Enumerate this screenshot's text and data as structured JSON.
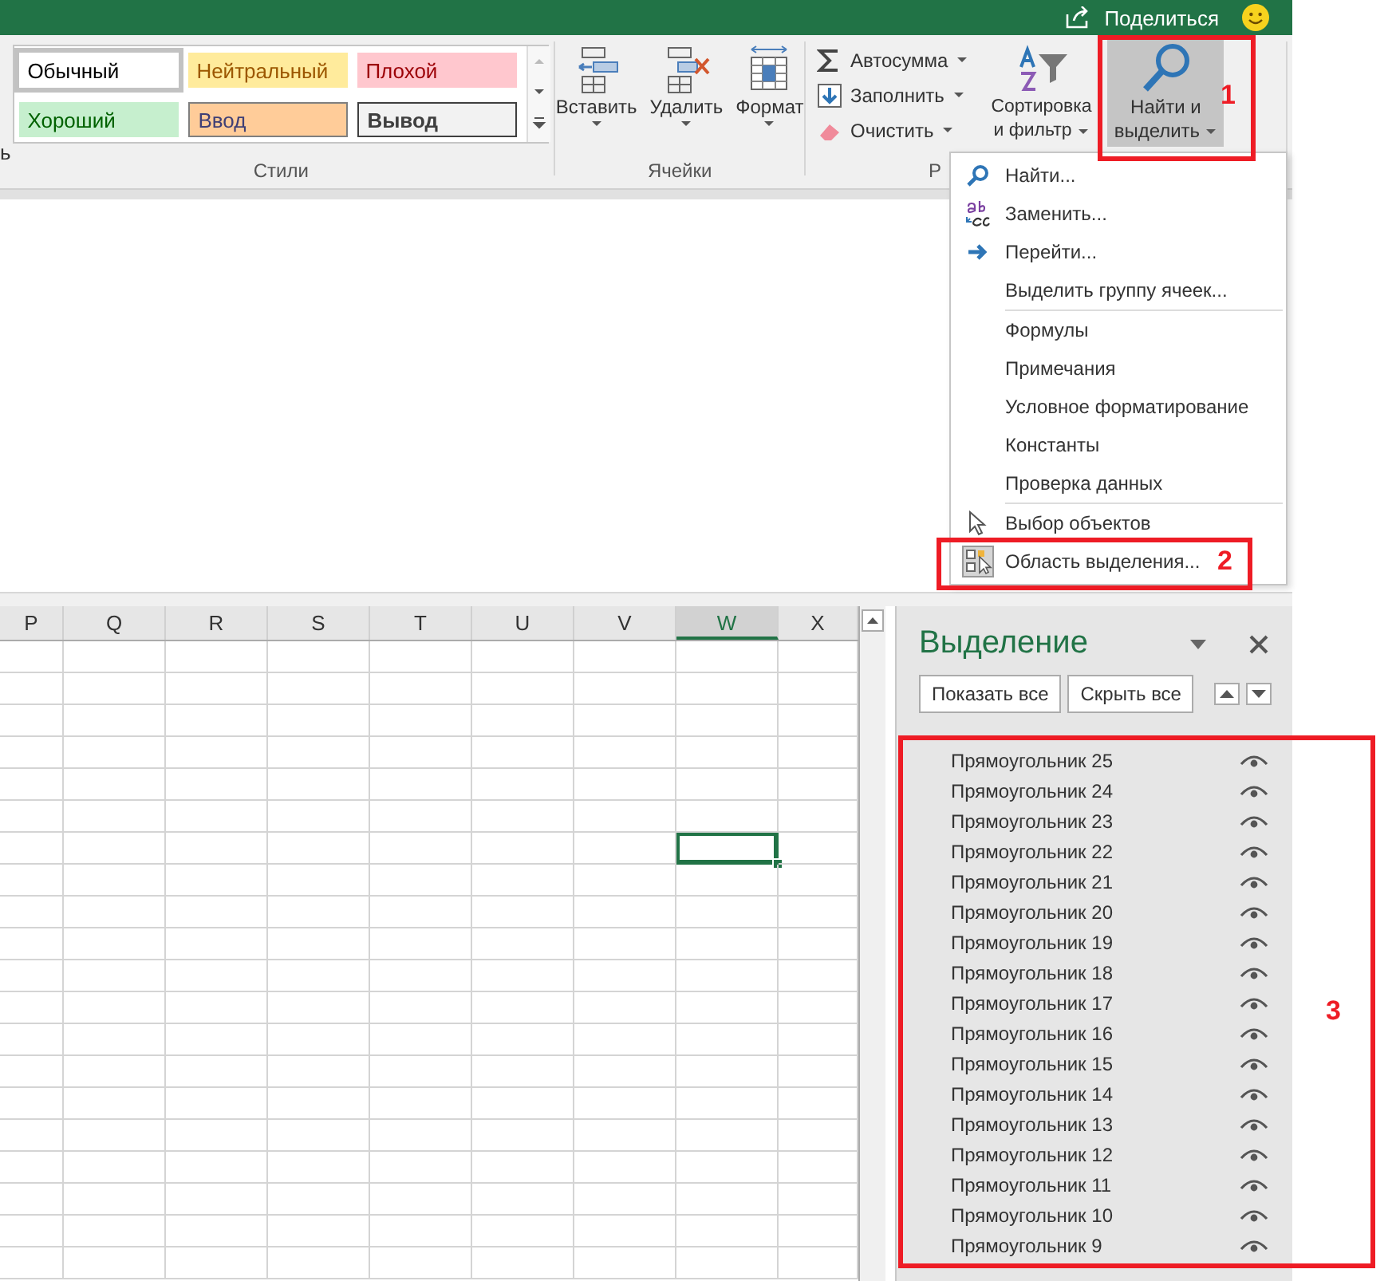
{
  "title_bar": {
    "share": "Поделиться"
  },
  "ribbon": {
    "left_fragment": "ь",
    "styles": {
      "label": "Стили",
      "items": [
        {
          "text": "Обычный",
          "kind": "normal",
          "selected": true
        },
        {
          "text": "Нейтральный",
          "kind": "neutral",
          "selected": false
        },
        {
          "text": "Плохой",
          "kind": "bad",
          "selected": false
        },
        {
          "text": "Хороший",
          "kind": "good",
          "selected": false
        },
        {
          "text": "Ввод",
          "kind": "input",
          "selected": false
        },
        {
          "text": "Вывод",
          "kind": "output",
          "selected": false
        }
      ]
    },
    "cells": {
      "label": "Ячейки",
      "buttons": [
        {
          "label": "Вставить",
          "kind": "insert"
        },
        {
          "label": "Удалить",
          "kind": "delete"
        },
        {
          "label": "Формат",
          "kind": "format"
        }
      ]
    },
    "editing": {
      "label": "Р",
      "commands": [
        {
          "label": "Автосумма",
          "kind": "sum"
        },
        {
          "label": "Заполнить",
          "kind": "fill"
        },
        {
          "label": "Очистить",
          "kind": "clear"
        }
      ],
      "sort": {
        "lines": [
          "Сортировка",
          "и фильтр"
        ]
      },
      "find": {
        "lines": [
          "Найти и",
          "выделить"
        ],
        "selected": true
      }
    }
  },
  "menu": {
    "groups": [
      [
        {
          "label": "Найти...",
          "kind": "find"
        },
        {
          "label": "Заменить...",
          "kind": "replace"
        },
        {
          "label": "Перейти...",
          "kind": "goto"
        },
        {
          "label": "Выделить группу ячеек...",
          "kind": "plain"
        }
      ],
      [
        {
          "label": "Формулы",
          "kind": "plain"
        },
        {
          "label": "Примечания",
          "kind": "plain"
        },
        {
          "label": "Условное форматирование",
          "kind": "plain"
        },
        {
          "label": "Константы",
          "kind": "plain"
        },
        {
          "label": "Проверка данных",
          "kind": "plain"
        }
      ],
      [
        {
          "label": "Выбор объектов",
          "kind": "pointer"
        },
        {
          "label": "Область выделения...",
          "kind": "pane"
        }
      ]
    ]
  },
  "sheet": {
    "columns": [
      {
        "name": "P",
        "selected": false
      },
      {
        "name": "Q",
        "selected": false
      },
      {
        "name": "R",
        "selected": false
      },
      {
        "name": "S",
        "selected": false
      },
      {
        "name": "T",
        "selected": false
      },
      {
        "name": "U",
        "selected": false
      },
      {
        "name": "V",
        "selected": false
      },
      {
        "name": "W",
        "selected": true
      },
      {
        "name": "X",
        "selected": false
      }
    ],
    "rows": [
      {
        "selected": false
      },
      {
        "selected": false
      },
      {
        "selected": false
      },
      {
        "selected": false
      },
      {
        "selected": false
      },
      {
        "selected": false
      },
      {
        "selected": true
      },
      {
        "selected": false
      },
      {
        "selected": false
      },
      {
        "selected": false
      },
      {
        "selected": false
      },
      {
        "selected": false
      },
      {
        "selected": false
      },
      {
        "selected": false
      },
      {
        "selected": false
      },
      {
        "selected": false
      },
      {
        "selected": false
      },
      {
        "selected": false
      },
      {
        "selected": false
      },
      {
        "selected": false
      }
    ]
  },
  "selection_pane": {
    "title": "Выделение",
    "buttons": [
      "Показать все",
      "Скрыть все"
    ],
    "items": [
      {
        "name": "Прямоугольник 25",
        "visible": true
      },
      {
        "name": "Прямоугольник 24",
        "visible": true
      },
      {
        "name": "Прямоугольник 23",
        "visible": true
      },
      {
        "name": "Прямоугольник 22",
        "visible": true
      },
      {
        "name": "Прямоугольник 21",
        "visible": true
      },
      {
        "name": "Прямоугольник 20",
        "visible": true
      },
      {
        "name": "Прямоугольник 19",
        "visible": true
      },
      {
        "name": "Прямоугольник 18",
        "visible": true
      },
      {
        "name": "Прямоугольник 17",
        "visible": true
      },
      {
        "name": "Прямоугольник 16",
        "visible": true
      },
      {
        "name": "Прямоугольник 15",
        "visible": true
      },
      {
        "name": "Прямоугольник 14",
        "visible": true
      },
      {
        "name": "Прямоугольник 13",
        "visible": true
      },
      {
        "name": "Прямоугольник 12",
        "visible": true
      },
      {
        "name": "Прямоугольник 11",
        "visible": true
      },
      {
        "name": "Прямоугольник 10",
        "visible": true
      },
      {
        "name": "Прямоугольник 9",
        "visible": true
      }
    ]
  },
  "annotations": [
    {
      "label": "1"
    },
    {
      "label": "2"
    },
    {
      "label": "3"
    }
  ]
}
